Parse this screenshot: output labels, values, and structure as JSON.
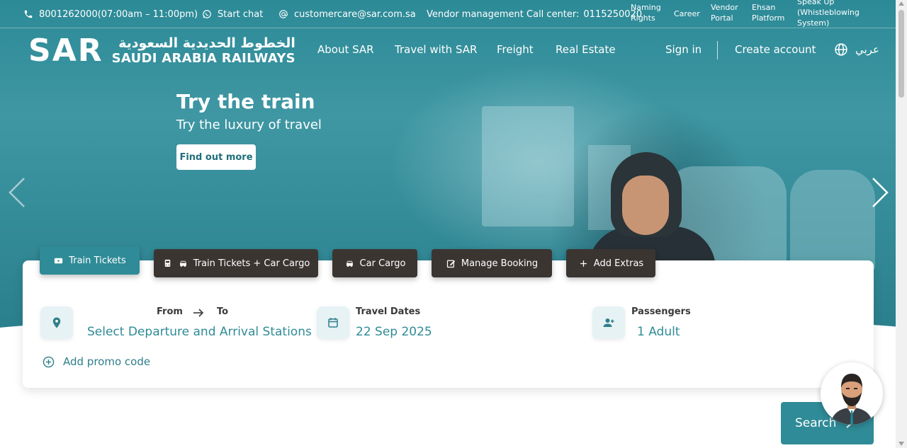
{
  "topbar": {
    "phone": "8001262000(07:00am – 11:00pm)",
    "chat": "Start chat",
    "email": "customercare@sar.com.sa",
    "vendor_call_label": "Vendor management Call center:",
    "vendor_call_number": "0115250020",
    "links": [
      "Naming Rights",
      "Career",
      "Vendor Portal",
      "Ehsan Platform",
      "Speak Up (Whistleblowing System)"
    ]
  },
  "brand": {
    "mark": "SAR",
    "arabic": "الخطوط الحديدية السعودية",
    "english": "SAUDI ARABIA RAILWAYS"
  },
  "nav": {
    "items": [
      "About SAR",
      "Travel with SAR",
      "Freight",
      "Real Estate"
    ],
    "sign_in": "Sign in",
    "create_account": "Create account",
    "language": "عربي"
  },
  "hero": {
    "title": "Try the train",
    "subtitle": "Try the luxury of travel",
    "cta": "Find out more"
  },
  "tabs": [
    {
      "label": "Train Tickets",
      "active": true
    },
    {
      "label": "Train Tickets + Car Cargo",
      "active": false
    },
    {
      "label": "Car Cargo",
      "active": false
    },
    {
      "label": "Manage Booking",
      "active": false
    },
    {
      "label": "Add Extras",
      "active": false
    }
  ],
  "booking": {
    "from_label": "From",
    "to_label": "To",
    "stations_placeholder": "Select Departure and Arrival Stations",
    "dates_label": "Travel Dates",
    "dates_value": "22 Sep 2025",
    "passengers_label": "Passengers",
    "passengers_value": "1 Adult",
    "promo": "Add promo code",
    "search": "Search"
  },
  "colors": {
    "accent": "#2f8b97",
    "dark_tab": "#3b3532"
  }
}
